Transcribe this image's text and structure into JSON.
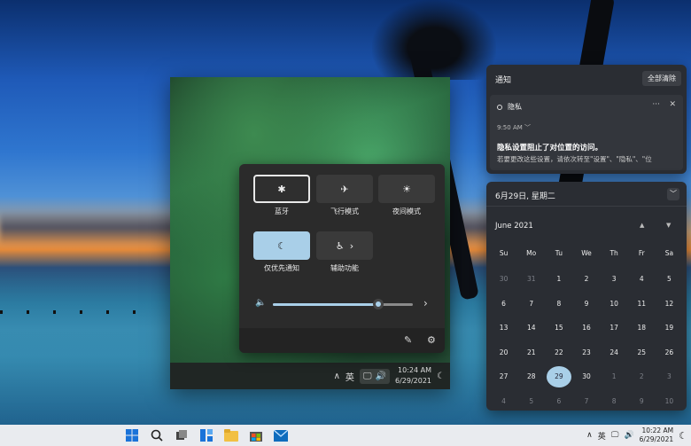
{
  "quick_settings": {
    "tiles": [
      {
        "label": "蓝牙",
        "icon": "bluetooth-icon",
        "glyph": "✱"
      },
      {
        "label": "飞行模式",
        "icon": "airplane-icon",
        "glyph": "✈"
      },
      {
        "label": "夜间模式",
        "icon": "brightness-icon",
        "glyph": "☀"
      },
      {
        "label": "仅优先通知",
        "icon": "moon-icon",
        "glyph": "☾"
      },
      {
        "label": "辅助功能",
        "icon": "accessibility-icon",
        "glyph": "♿",
        "chevron": "›"
      }
    ],
    "volume_level": 0.75,
    "volume_chevron": "›"
  },
  "notifications": {
    "title": "通知",
    "clear_all": "全部清除",
    "card": {
      "app": "隐私",
      "more": "···",
      "close": "✕",
      "time": "9:50 AM  ﹀",
      "title": "隐私设置阻止了对位置的访问。",
      "body": "若要更改这些设置，请依次转至\"设置\"、\"隐私\"、\"位"
    }
  },
  "calendar": {
    "date_header": "6月29日, 星期二",
    "collapse": "﹀",
    "month": "June 2021",
    "nav_up": "▲",
    "nav_down": "▼",
    "weekdays": [
      "Su",
      "Mo",
      "Tu",
      "We",
      "Th",
      "Fr",
      "Sa"
    ],
    "days": [
      {
        "d": "30",
        "dim": true
      },
      {
        "d": "31",
        "dim": true
      },
      {
        "d": "1"
      },
      {
        "d": "2"
      },
      {
        "d": "3"
      },
      {
        "d": "4"
      },
      {
        "d": "5"
      },
      {
        "d": "6"
      },
      {
        "d": "7"
      },
      {
        "d": "8"
      },
      {
        "d": "9"
      },
      {
        "d": "10"
      },
      {
        "d": "11"
      },
      {
        "d": "12"
      },
      {
        "d": "13"
      },
      {
        "d": "14"
      },
      {
        "d": "15"
      },
      {
        "d": "16"
      },
      {
        "d": "17"
      },
      {
        "d": "18"
      },
      {
        "d": "19"
      },
      {
        "d": "20"
      },
      {
        "d": "21"
      },
      {
        "d": "22"
      },
      {
        "d": "23"
      },
      {
        "d": "24"
      },
      {
        "d": "25"
      },
      {
        "d": "26"
      },
      {
        "d": "27"
      },
      {
        "d": "28"
      },
      {
        "d": "29",
        "today": true
      },
      {
        "d": "30"
      },
      {
        "d": "1",
        "dim": true
      },
      {
        "d": "2",
        "dim": true
      },
      {
        "d": "3",
        "dim": true
      },
      {
        "d": "4",
        "dim": true
      },
      {
        "d": "5",
        "dim": true
      },
      {
        "d": "6",
        "dim": true
      },
      {
        "d": "7",
        "dim": true
      },
      {
        "d": "8",
        "dim": true
      },
      {
        "d": "9",
        "dim": true
      },
      {
        "d": "10",
        "dim": true
      }
    ]
  },
  "inner_taskbar": {
    "chevron": "∧",
    "ime": "英",
    "time": "10:24 AM",
    "date": "6/29/2021"
  },
  "taskbar": {
    "icons": [
      "windows-start-icon",
      "search-icon",
      "task-view-icon",
      "widgets-icon",
      "file-explorer-icon",
      "store-icon",
      "mail-icon"
    ],
    "chevron": "∧",
    "ime": "英",
    "time": "10:22 AM",
    "date": "6/29/2021"
  },
  "colors": {
    "accent": "#a9cfe8",
    "panel": "#2a2d33"
  }
}
